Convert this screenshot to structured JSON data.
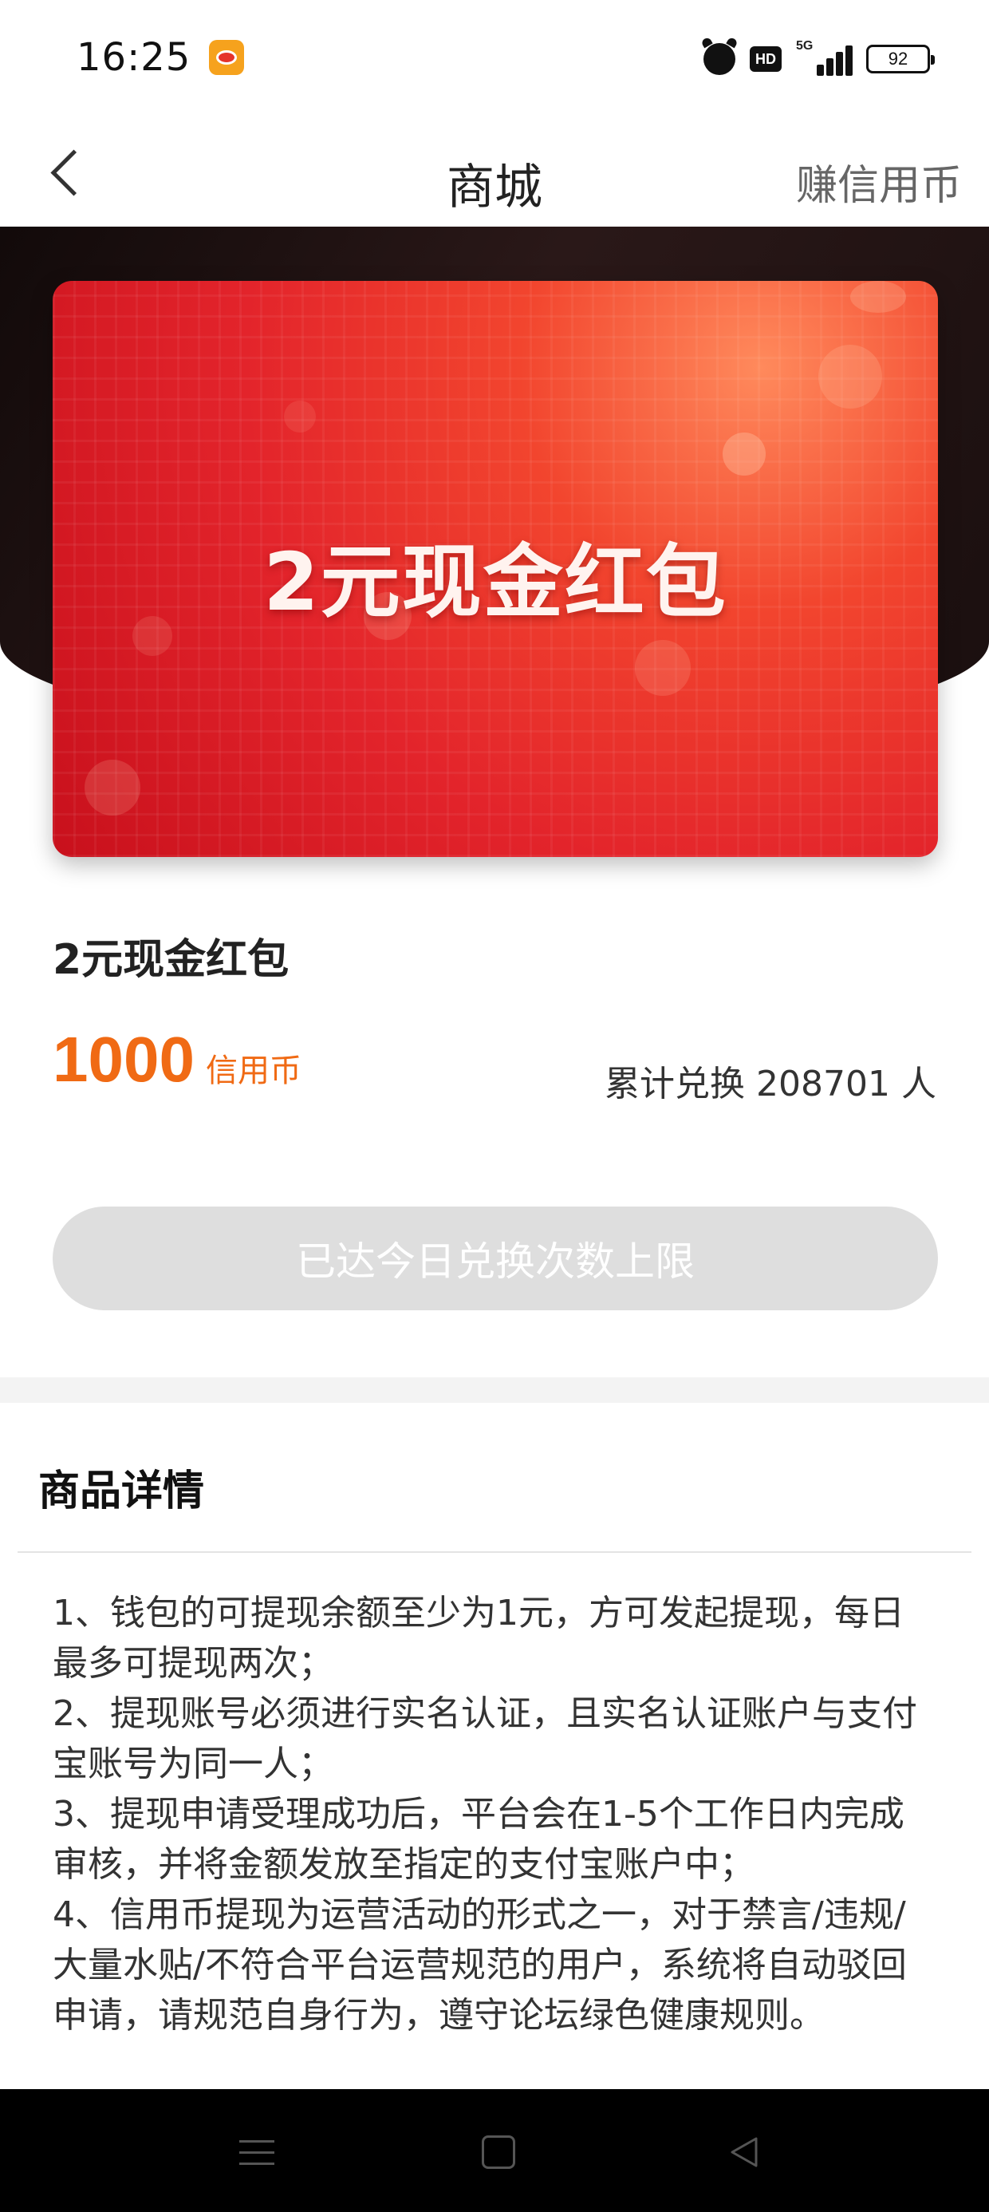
{
  "status_bar": {
    "time": "16:25",
    "network": "5G",
    "hd_label": "HD",
    "battery": "92"
  },
  "nav": {
    "title": "商城",
    "action": "赚信用币"
  },
  "hero": {
    "card_title": "2元现金红包"
  },
  "product": {
    "name": "2元现金红包",
    "price_value": "1000",
    "price_unit": "信用币",
    "redeem_count": "累计兑换 208701 人",
    "redeem_button": "已达今日兑换次数上限"
  },
  "details": {
    "title": "商品详情",
    "lines": [
      "1、钱包的可提现余额至少为1元，方可发起提现，每日最多可提现两次；",
      "2、提现账号必须进行实名认证，且实名认证账户与支付宝账号为同一人；",
      "3、提现申请受理成功后，平台会在1-5个工作日内完成审核，并将金额发放至指定的支付宝账户中；",
      "4、信用币提现为运营活动的形式之一，对于禁言/违规/大量水贴/不符合平台运营规范的用户，系统将自动驳回申请，请规范自身行为，遵守论坛绿色健康规则。"
    ]
  },
  "colors": {
    "accent": "#f06a14",
    "hero_red": "#e3242b",
    "disabled_button": "#dedede"
  },
  "icons": {
    "back": "chevron-left-icon",
    "app_notification": "weibo-icon",
    "alarm": "alarm-icon",
    "signal": "signal-icon",
    "battery": "battery-icon",
    "sys_menu": "menu-icon",
    "sys_home": "home-icon",
    "sys_back": "triangle-back-icon"
  }
}
